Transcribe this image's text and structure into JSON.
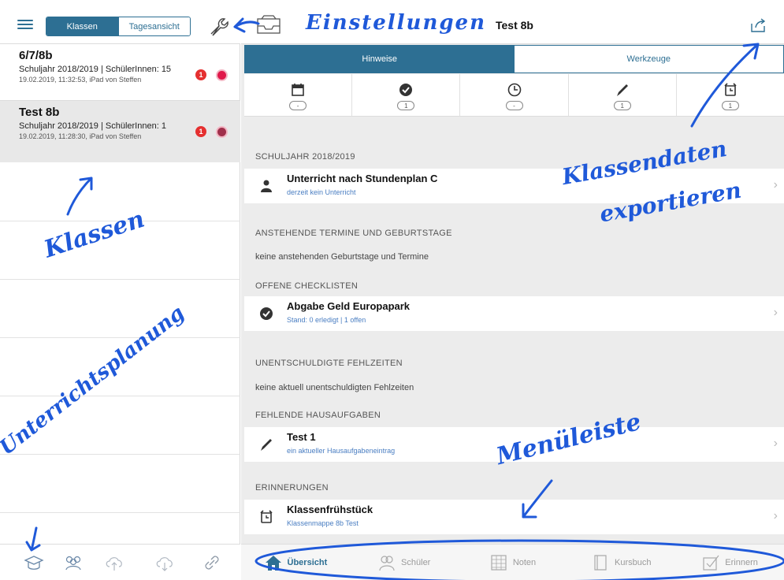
{
  "sidebar": {
    "segment": {
      "classes": "Klassen",
      "day_view": "Tagesansicht"
    },
    "classes": [
      {
        "name": "6/7/8b",
        "meta": "Schuljahr 2018/2019 | SchülerInnen: 15",
        "date": "19.02.2019, 11:32:53, iPad von Steffen",
        "badge": "1"
      },
      {
        "name": "Test 8b",
        "meta": "Schuljahr 2018/2019 | SchülerInnen: 1",
        "date": "19.02.2019, 11:28:30, iPad von Steffen",
        "badge": "1"
      }
    ],
    "bottom_icons": [
      "graduation-cap-icon",
      "group-icon",
      "cloud-upload-icon",
      "cloud-download-icon",
      "link-icon"
    ]
  },
  "header": {
    "title": "Test 8b"
  },
  "tabs": [
    {
      "label": "Hinweise",
      "active": true
    },
    {
      "label": "Werkzeuge",
      "active": false
    }
  ],
  "status_icons": [
    {
      "icon": "calendar-icon",
      "count": "-"
    },
    {
      "icon": "check-circle-icon",
      "count": "1"
    },
    {
      "icon": "clock-icon",
      "count": "-"
    },
    {
      "icon": "pen-icon",
      "count": "1"
    },
    {
      "icon": "alarm-clock-icon",
      "count": "1"
    }
  ],
  "content": {
    "school_year_header": "SCHULJAHR 2018/2019",
    "timetable": {
      "title": "Unterricht nach Stundenplan C",
      "subtitle": "derzeit kein Unterricht"
    },
    "upcoming_header": "ANSTEHENDE TERMINE UND GEBURTSTAGE",
    "upcoming_text": "keine anstehenden Geburtstage und Termine",
    "checklists_header": "OFFENE CHECKLISTEN",
    "checklist": {
      "title": "Abgabe Geld Europapark",
      "subtitle": "Stand: 0 erledigt | 1 offen"
    },
    "absences_header": "UNENTSCHULDIGTE FEHLZEITEN",
    "absences_text": "keine aktuell unentschuldigten Fehlzeiten",
    "homework_header": "FEHLENDE HAUSAUFGABEN",
    "homework": {
      "title": "Test 1",
      "subtitle": "ein aktueller Hausaufgabeneintrag"
    },
    "reminders_header": "ERINNERUNGEN",
    "reminder": {
      "title": "Klassenfrühstück",
      "subtitle": "Klassenmappe 8b Test"
    }
  },
  "bottom_nav": [
    {
      "label": "Übersicht",
      "icon": "house-icon",
      "active": true
    },
    {
      "label": "Schüler",
      "icon": "students-icon",
      "active": false
    },
    {
      "label": "Noten",
      "icon": "grades-icon",
      "active": false
    },
    {
      "label": "Kursbuch",
      "icon": "book-icon",
      "active": false
    },
    {
      "label": "Erinnern",
      "icon": "reminder-check-icon",
      "active": false
    }
  ],
  "annotations": {
    "settings": "Einstellungen",
    "classes": "Klassen",
    "export": [
      "Klassendaten",
      "exportieren"
    ],
    "planning": "Unterrichtsplanung",
    "menubar": "Menüleiste"
  },
  "colors": {
    "accent": "#2d6f93",
    "annotation": "#1f59d9",
    "alert": "#e53030"
  }
}
